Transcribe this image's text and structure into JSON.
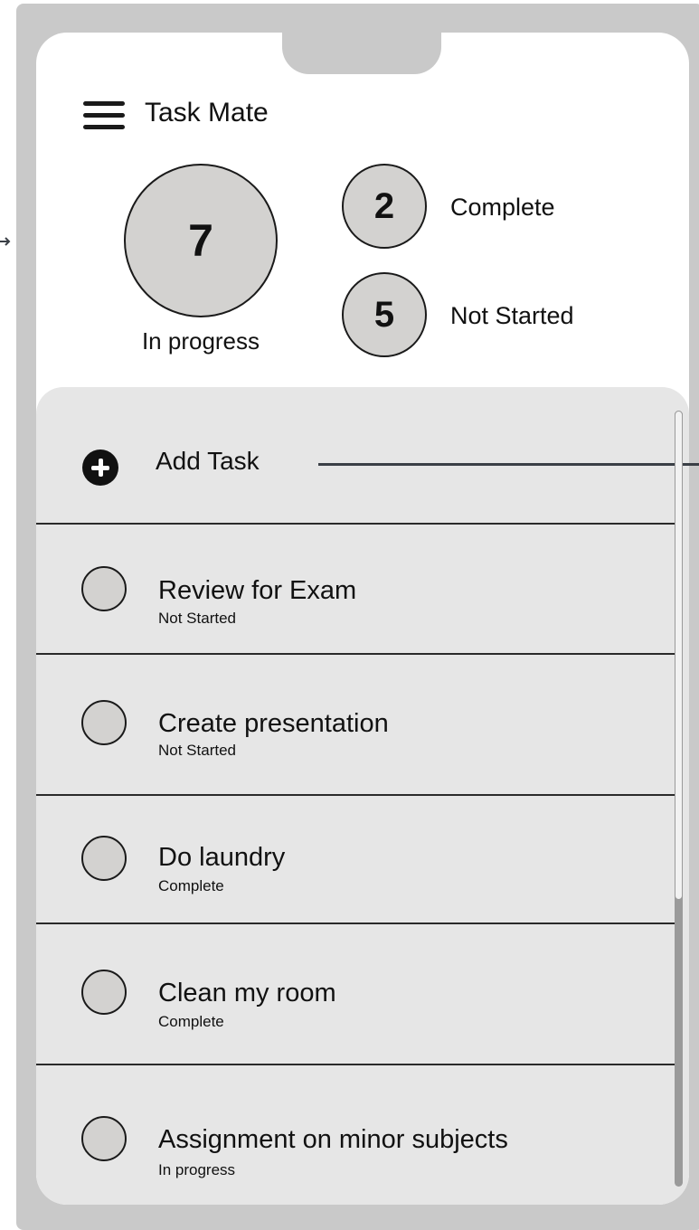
{
  "app": {
    "title": "Task Mate"
  },
  "stats": {
    "in_progress": {
      "count": "7",
      "label": "In progress"
    },
    "complete": {
      "count": "2",
      "label": "Complete"
    },
    "not_started": {
      "count": "5",
      "label": "Not Started"
    }
  },
  "add_task": {
    "label": "Add Task"
  },
  "tasks": [
    {
      "title": "Review for Exam",
      "status": "Not Started"
    },
    {
      "title": "Create presentation",
      "status": "Not Started"
    },
    {
      "title": "Do laundry",
      "status": "Complete"
    },
    {
      "title": "Clean my room",
      "status": "Complete"
    },
    {
      "title": "Assignment on minor subjects",
      "status": "In progress"
    }
  ],
  "scrollbar": {
    "visible_fraction": 0.63
  }
}
